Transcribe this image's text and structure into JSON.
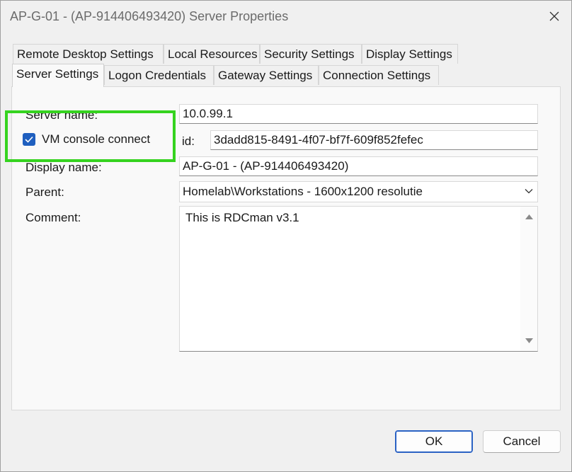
{
  "window": {
    "title": "AP-G-01 - (AP-914406493420) Server Properties"
  },
  "tabs_top": [
    {
      "label": "Remote Desktop Settings"
    },
    {
      "label": "Local Resources"
    },
    {
      "label": "Security Settings"
    },
    {
      "label": "Display Settings"
    }
  ],
  "tabs_bottom": [
    {
      "label": "Server Settings"
    },
    {
      "label": "Logon Credentials"
    },
    {
      "label": "Gateway Settings"
    },
    {
      "label": "Connection Settings"
    }
  ],
  "form": {
    "server_name_label": "Server name:",
    "server_name_value": "10.0.99.1",
    "vm_console_label": "VM console connect",
    "vm_console_checked": true,
    "id_label": "id:",
    "id_value": "3dadd815-8491-4f07-bf7f-609f852fefec",
    "display_name_label": "Display name:",
    "display_name_value": "AP-G-01 - (AP-914406493420)",
    "parent_label": "Parent:",
    "parent_value": "Homelab\\Workstations - 1600x1200 resolutie",
    "comment_label": "Comment:",
    "comment_value": "This is RDCman v3.1"
  },
  "buttons": {
    "ok": "OK",
    "cancel": "Cancel"
  },
  "colors": {
    "highlight": "#35d31f",
    "checkbox": "#1f5fbf",
    "ok_border": "#2a62c4"
  },
  "icons": [
    "close-icon",
    "checkmark-icon",
    "chevron-down-icon",
    "scroll-up-icon",
    "scroll-down-icon"
  ]
}
